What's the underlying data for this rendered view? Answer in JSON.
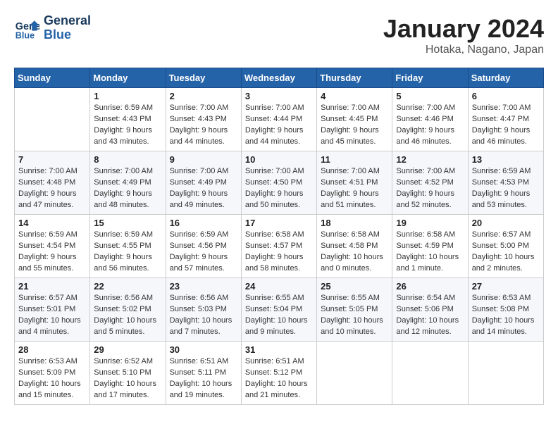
{
  "header": {
    "logo_line1": "General",
    "logo_line2": "Blue",
    "title": "January 2024",
    "subtitle": "Hotaka, Nagano, Japan"
  },
  "days_of_week": [
    "Sunday",
    "Monday",
    "Tuesday",
    "Wednesday",
    "Thursday",
    "Friday",
    "Saturday"
  ],
  "weeks": [
    [
      {
        "day": "",
        "info": ""
      },
      {
        "day": "1",
        "info": "Sunrise: 6:59 AM\nSunset: 4:43 PM\nDaylight: 9 hours\nand 43 minutes."
      },
      {
        "day": "2",
        "info": "Sunrise: 7:00 AM\nSunset: 4:43 PM\nDaylight: 9 hours\nand 44 minutes."
      },
      {
        "day": "3",
        "info": "Sunrise: 7:00 AM\nSunset: 4:44 PM\nDaylight: 9 hours\nand 44 minutes."
      },
      {
        "day": "4",
        "info": "Sunrise: 7:00 AM\nSunset: 4:45 PM\nDaylight: 9 hours\nand 45 minutes."
      },
      {
        "day": "5",
        "info": "Sunrise: 7:00 AM\nSunset: 4:46 PM\nDaylight: 9 hours\nand 46 minutes."
      },
      {
        "day": "6",
        "info": "Sunrise: 7:00 AM\nSunset: 4:47 PM\nDaylight: 9 hours\nand 46 minutes."
      }
    ],
    [
      {
        "day": "7",
        "info": "Sunrise: 7:00 AM\nSunset: 4:48 PM\nDaylight: 9 hours\nand 47 minutes."
      },
      {
        "day": "8",
        "info": "Sunrise: 7:00 AM\nSunset: 4:49 PM\nDaylight: 9 hours\nand 48 minutes."
      },
      {
        "day": "9",
        "info": "Sunrise: 7:00 AM\nSunset: 4:49 PM\nDaylight: 9 hours\nand 49 minutes."
      },
      {
        "day": "10",
        "info": "Sunrise: 7:00 AM\nSunset: 4:50 PM\nDaylight: 9 hours\nand 50 minutes."
      },
      {
        "day": "11",
        "info": "Sunrise: 7:00 AM\nSunset: 4:51 PM\nDaylight: 9 hours\nand 51 minutes."
      },
      {
        "day": "12",
        "info": "Sunrise: 7:00 AM\nSunset: 4:52 PM\nDaylight: 9 hours\nand 52 minutes."
      },
      {
        "day": "13",
        "info": "Sunrise: 6:59 AM\nSunset: 4:53 PM\nDaylight: 9 hours\nand 53 minutes."
      }
    ],
    [
      {
        "day": "14",
        "info": "Sunrise: 6:59 AM\nSunset: 4:54 PM\nDaylight: 9 hours\nand 55 minutes."
      },
      {
        "day": "15",
        "info": "Sunrise: 6:59 AM\nSunset: 4:55 PM\nDaylight: 9 hours\nand 56 minutes."
      },
      {
        "day": "16",
        "info": "Sunrise: 6:59 AM\nSunset: 4:56 PM\nDaylight: 9 hours\nand 57 minutes."
      },
      {
        "day": "17",
        "info": "Sunrise: 6:58 AM\nSunset: 4:57 PM\nDaylight: 9 hours\nand 58 minutes."
      },
      {
        "day": "18",
        "info": "Sunrise: 6:58 AM\nSunset: 4:58 PM\nDaylight: 10 hours\nand 0 minutes."
      },
      {
        "day": "19",
        "info": "Sunrise: 6:58 AM\nSunset: 4:59 PM\nDaylight: 10 hours\nand 1 minute."
      },
      {
        "day": "20",
        "info": "Sunrise: 6:57 AM\nSunset: 5:00 PM\nDaylight: 10 hours\nand 2 minutes."
      }
    ],
    [
      {
        "day": "21",
        "info": "Sunrise: 6:57 AM\nSunset: 5:01 PM\nDaylight: 10 hours\nand 4 minutes."
      },
      {
        "day": "22",
        "info": "Sunrise: 6:56 AM\nSunset: 5:02 PM\nDaylight: 10 hours\nand 5 minutes."
      },
      {
        "day": "23",
        "info": "Sunrise: 6:56 AM\nSunset: 5:03 PM\nDaylight: 10 hours\nand 7 minutes."
      },
      {
        "day": "24",
        "info": "Sunrise: 6:55 AM\nSunset: 5:04 PM\nDaylight: 10 hours\nand 9 minutes."
      },
      {
        "day": "25",
        "info": "Sunrise: 6:55 AM\nSunset: 5:05 PM\nDaylight: 10 hours\nand 10 minutes."
      },
      {
        "day": "26",
        "info": "Sunrise: 6:54 AM\nSunset: 5:06 PM\nDaylight: 10 hours\nand 12 minutes."
      },
      {
        "day": "27",
        "info": "Sunrise: 6:53 AM\nSunset: 5:08 PM\nDaylight: 10 hours\nand 14 minutes."
      }
    ],
    [
      {
        "day": "28",
        "info": "Sunrise: 6:53 AM\nSunset: 5:09 PM\nDaylight: 10 hours\nand 15 minutes."
      },
      {
        "day": "29",
        "info": "Sunrise: 6:52 AM\nSunset: 5:10 PM\nDaylight: 10 hours\nand 17 minutes."
      },
      {
        "day": "30",
        "info": "Sunrise: 6:51 AM\nSunset: 5:11 PM\nDaylight: 10 hours\nand 19 minutes."
      },
      {
        "day": "31",
        "info": "Sunrise: 6:51 AM\nSunset: 5:12 PM\nDaylight: 10 hours\nand 21 minutes."
      },
      {
        "day": "",
        "info": ""
      },
      {
        "day": "",
        "info": ""
      },
      {
        "day": "",
        "info": ""
      }
    ]
  ]
}
